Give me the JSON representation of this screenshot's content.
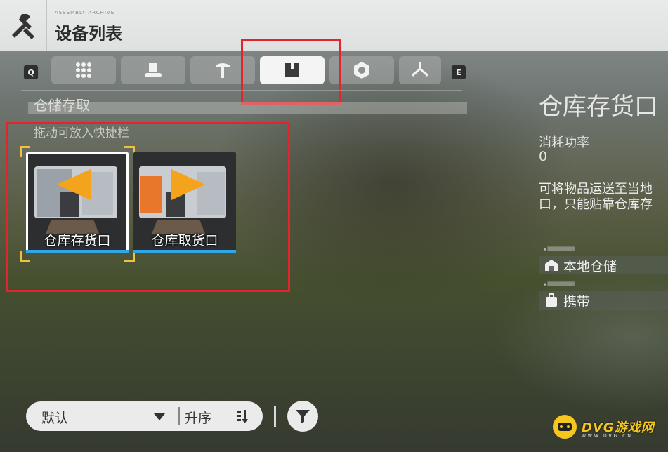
{
  "header": {
    "brand_mark": "ASSEMBLY ARCHIVE",
    "title": "设备列表"
  },
  "tabs": {
    "left_key": "Q",
    "right_key": "E",
    "items": [
      {
        "icon": "grid-icon"
      },
      {
        "icon": "conveyor-machine-icon"
      },
      {
        "icon": "pickaxe-icon"
      },
      {
        "icon": "storage-box-icon",
        "active": true
      },
      {
        "icon": "hex-nut-icon"
      },
      {
        "icon": "fan-blade-icon"
      }
    ]
  },
  "category": {
    "title": "仓储存取",
    "hint": "拖动可放入快捷栏"
  },
  "cards": [
    {
      "label": "仓库存货口",
      "arrow": "left",
      "selected": true
    },
    {
      "label": "仓库取货口",
      "arrow": "right",
      "selected": false
    }
  ],
  "detail": {
    "title": "仓库存货口",
    "power_label": "消耗功率",
    "power_value": "0",
    "desc_line1": "可将物品运送至当地",
    "desc_line2": "口，只能贴靠仓库存",
    "tag1": "本地仓储",
    "tag2": "携带"
  },
  "sort_bar": {
    "sort_value": "默认",
    "order_value": "升序"
  },
  "watermark": {
    "text": "DVG游戏网",
    "sub": "WWW.DVG.CN"
  },
  "colors": {
    "highlight_red": "#e2252c",
    "card_bar_blue": "#2fa6e8",
    "selection_corner": "#f0c040",
    "watermark_yellow": "#f4c820"
  }
}
